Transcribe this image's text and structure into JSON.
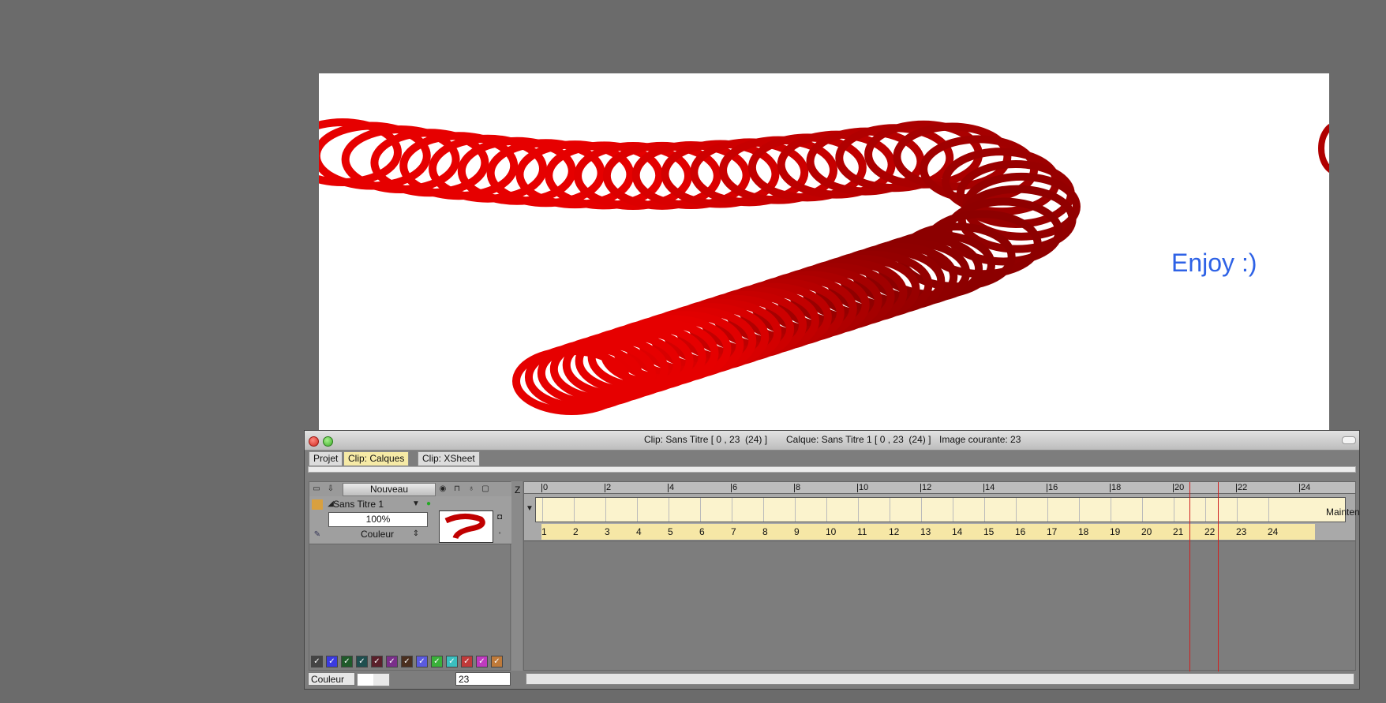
{
  "canvas": {
    "text": "Enjoy :)",
    "text_color": "#2e62e6"
  },
  "window": {
    "title_clip": "Clip: Sans Titre [ 0 , 23  (24) ]",
    "title_layer": "Calque: Sans Titre 1 [ 0 , 23  (24) ]",
    "title_image": "Image courante: 23"
  },
  "tabs": [
    {
      "label": "Projet",
      "active": false
    },
    {
      "label": "Clip: Calques",
      "active": true
    },
    {
      "label": "Clip: XSheet",
      "active": false
    }
  ],
  "layers_panel": {
    "new_button": "Nouveau",
    "z_label": "Z",
    "layer": {
      "name": "Sans Titre 1",
      "opacity": "100%",
      "mode": "Couleur"
    },
    "swatch_colors": [
      "#444444",
      "#3a3adf",
      "#1f5a2a",
      "#1f4f4f",
      "#5a1f2a",
      "#7a2f8a",
      "#4a2f1f",
      "#5a5adf",
      "#3ab03a",
      "#3abfbf",
      "#bf3a3a",
      "#bf3abf",
      "#bf7a3a"
    ]
  },
  "bottom_bar": {
    "mode": "Couleur",
    "frame_value": "23"
  },
  "timeline": {
    "ruler_ticks": [
      "0",
      "2",
      "4",
      "6",
      "8",
      "10",
      "12",
      "14",
      "16",
      "18",
      "20",
      "22",
      "24"
    ],
    "frame_numbers": [
      "1",
      "2",
      "3",
      "4",
      "5",
      "6",
      "7",
      "8",
      "9",
      "10",
      "11",
      "12",
      "13",
      "14",
      "15",
      "16",
      "17",
      "18",
      "19",
      "20",
      "21",
      "22",
      "23",
      "24"
    ],
    "track_label": "Maintenir"
  }
}
